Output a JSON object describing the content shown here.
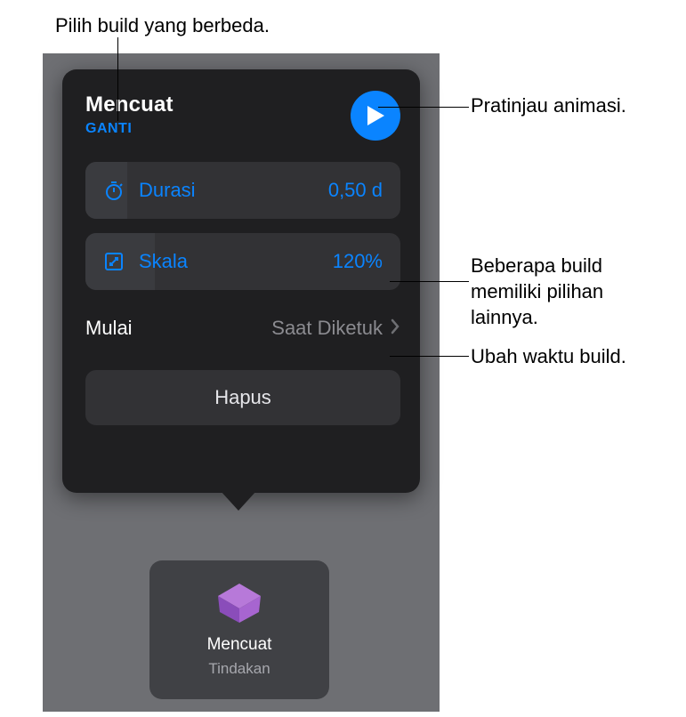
{
  "callouts": {
    "choose_build": "Pilih build yang berbeda.",
    "preview": "Pratinjau animasi.",
    "options": "Beberapa build memiliki pilihan lainnya.",
    "timing": "Ubah waktu build."
  },
  "popover": {
    "title": "Mencuat",
    "change_link": "GANTI",
    "duration": {
      "label": "Durasi",
      "value": "0,50 d"
    },
    "scale": {
      "label": "Skala",
      "value": "120%"
    },
    "start": {
      "label": "Mulai",
      "value": "Saat Diketuk"
    },
    "delete_label": "Hapus"
  },
  "tile": {
    "title": "Mencuat",
    "subtitle": "Tindakan"
  }
}
